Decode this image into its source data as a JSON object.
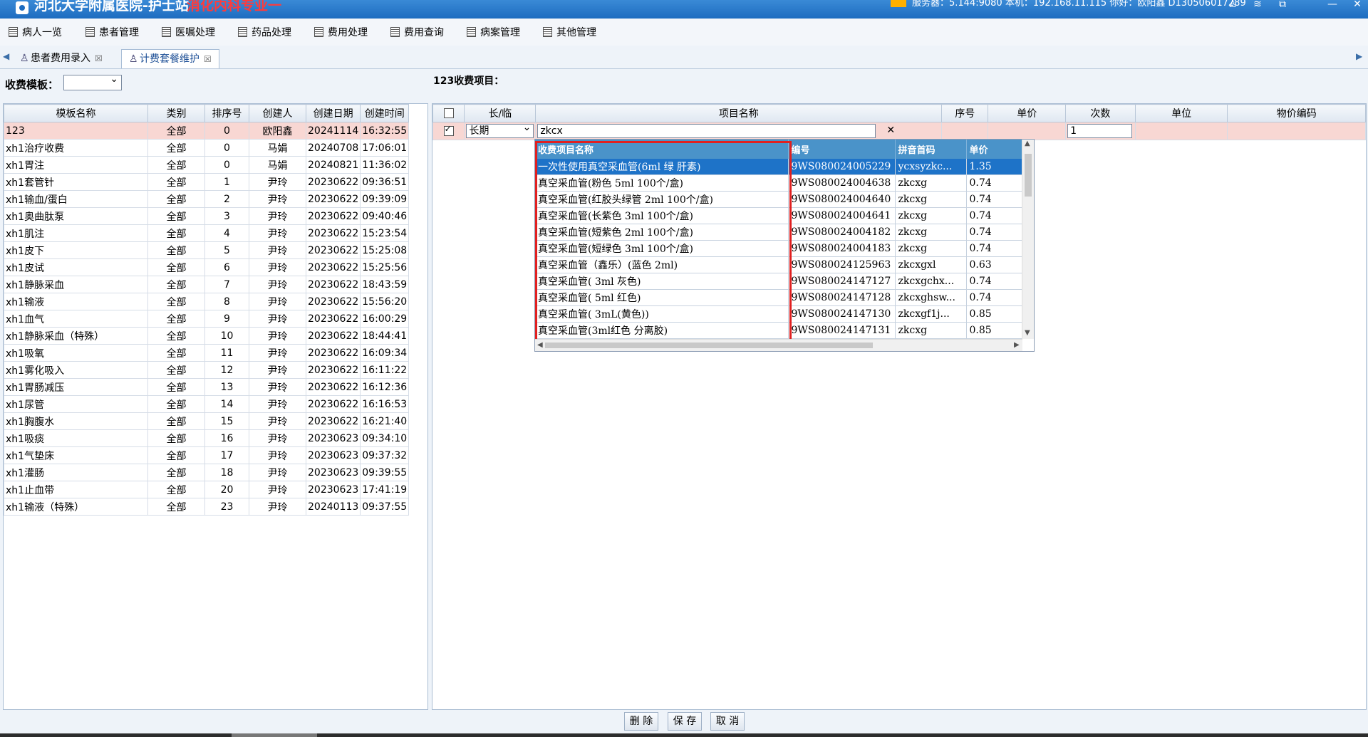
{
  "titlebar": {
    "app_title": "河北大学附属医院-护士站",
    "department": "消化内科专业一",
    "status": "服务器：5.144:9080 本机：192.168.11.115 你好：欧阳鑫 D130506017289"
  },
  "menu": [
    {
      "label": "病人一览"
    },
    {
      "label": "患者管理"
    },
    {
      "label": "医嘱处理"
    },
    {
      "label": "药品处理"
    },
    {
      "label": "费用处理"
    },
    {
      "label": "费用查询"
    },
    {
      "label": "病案管理"
    },
    {
      "label": "其他管理"
    }
  ],
  "tabs": [
    {
      "label": "患者费用录入",
      "active": false
    },
    {
      "label": "计费套餐维护",
      "active": true
    }
  ],
  "filter": {
    "template_label": "收费模板：",
    "template_value": "",
    "items_label": "123收费项目："
  },
  "template_table": {
    "columns": [
      "模板名称",
      "类别",
      "排序号",
      "创建人",
      "创建日期",
      "创建时间"
    ],
    "rows": [
      [
        "123",
        "全部",
        "0",
        "欧阳鑫",
        "20241114",
        "16:32:55"
      ],
      [
        "xh1治疗收费",
        "全部",
        "0",
        "马娟",
        "20240708",
        "17:06:01"
      ],
      [
        "xh1胃注",
        "全部",
        "0",
        "马娟",
        "20240821",
        "11:36:02"
      ],
      [
        "xh1套管针",
        "全部",
        "1",
        "尹玲",
        "20230622",
        "09:36:51"
      ],
      [
        "xh1输血/蛋白",
        "全部",
        "2",
        "尹玲",
        "20230622",
        "09:39:09"
      ],
      [
        "xh1奥曲肽泵",
        "全部",
        "3",
        "尹玲",
        "20230622",
        "09:40:46"
      ],
      [
        "xh1肌注",
        "全部",
        "4",
        "尹玲",
        "20230622",
        "15:23:54"
      ],
      [
        "xh1皮下",
        "全部",
        "5",
        "尹玲",
        "20230622",
        "15:25:08"
      ],
      [
        "xh1皮试",
        "全部",
        "6",
        "尹玲",
        "20230622",
        "15:25:56"
      ],
      [
        "xh1静脉采血",
        "全部",
        "7",
        "尹玲",
        "20230622",
        "18:43:59"
      ],
      [
        "xh1输液",
        "全部",
        "8",
        "尹玲",
        "20230622",
        "15:56:20"
      ],
      [
        "xh1血气",
        "全部",
        "9",
        "尹玲",
        "20230622",
        "16:00:29"
      ],
      [
        "xh1静脉采血（特殊）",
        "全部",
        "10",
        "尹玲",
        "20230622",
        "18:44:41"
      ],
      [
        "xh1吸氧",
        "全部",
        "11",
        "尹玲",
        "20230622",
        "16:09:34"
      ],
      [
        "xh1雾化吸入",
        "全部",
        "12",
        "尹玲",
        "20230622",
        "16:11:22"
      ],
      [
        "xh1胃肠减压",
        "全部",
        "13",
        "尹玲",
        "20230622",
        "16:12:36"
      ],
      [
        "xh1尿管",
        "全部",
        "14",
        "尹玲",
        "20230622",
        "16:16:53"
      ],
      [
        "xh1胸腹水",
        "全部",
        "15",
        "尹玲",
        "20230622",
        "16:21:40"
      ],
      [
        "xh1吸痰",
        "全部",
        "16",
        "尹玲",
        "20230623",
        "09:34:10"
      ],
      [
        "xh1气垫床",
        "全部",
        "17",
        "尹玲",
        "20230623",
        "09:37:32"
      ],
      [
        "xh1灌肠",
        "全部",
        "18",
        "尹玲",
        "20230623",
        "09:39:55"
      ],
      [
        "xh1止血带",
        "全部",
        "20",
        "尹玲",
        "20230623",
        "17:41:19"
      ],
      [
        "xh1输液（特殊）",
        "全部",
        "23",
        "尹玲",
        "20240113",
        "09:37:55"
      ]
    ]
  },
  "items_table": {
    "columns": [
      "",
      "长/临",
      "项目名称",
      "序号",
      "单价",
      "次数",
      "单位",
      "物价编码"
    ],
    "row": {
      "checked": true,
      "type": "长期",
      "name_input": "zkcx",
      "seq": "",
      "price": "",
      "count": "1",
      "unit": "",
      "code": ""
    },
    "clear_icon": "✕"
  },
  "popup": {
    "columns": [
      "收费项目名称",
      "编号",
      "拼音首码",
      "单价"
    ],
    "rows": [
      [
        "一次性使用真空采血管(6ml 绿 肝素)",
        "9WS080024005229",
        "ycxsyzkc...",
        "1.35"
      ],
      [
        "真空采血管(粉色 5ml 100个/盒)",
        "9WS080024004638",
        "zkcxg",
        "0.74"
      ],
      [
        "真空采血管(红胶头绿管 2ml 100个/盒)",
        "9WS080024004640",
        "zkcxg",
        "0.74"
      ],
      [
        "真空采血管(长紫色 3ml 100个/盒)",
        "9WS080024004641",
        "zkcxg",
        "0.74"
      ],
      [
        "真空采血管(短紫色 2ml 100个/盒)",
        "9WS080024004182",
        "zkcxg",
        "0.74"
      ],
      [
        "真空采血管(短绿色 3ml 100个/盒)",
        "9WS080024004183",
        "zkcxg",
        "0.74"
      ],
      [
        "真空采血管（鑫乐）(蓝色 2ml)",
        "9WS080024125963",
        "zkcxgxl",
        "0.63"
      ],
      [
        "真空采血管( 3ml 灰色)",
        "9WS080024147127",
        "zkcxgchx...",
        "0.74"
      ],
      [
        "真空采血管( 5ml  红色)",
        "9WS080024147128",
        "zkcxghsw...",
        "0.74"
      ],
      [
        "真空采血管( 3mL(黄色))",
        "9WS080024147130",
        "zkcxgf1j...",
        "0.85"
      ],
      [
        "真空采血管(3ml红色 分离胶)",
        "9WS080024147131",
        "zkcxg",
        "0.85"
      ]
    ]
  },
  "buttons": {
    "delete": "删 除",
    "save": "保 存",
    "cancel": "取 消"
  }
}
